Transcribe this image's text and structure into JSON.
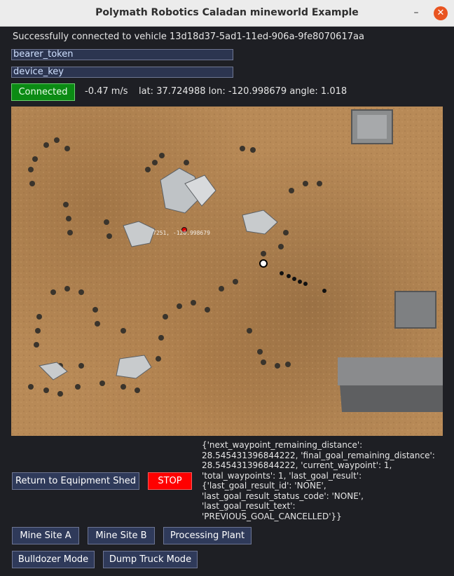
{
  "window": {
    "title": "Polymath Robotics Caladan mineworld Example",
    "min_label": "–",
    "close_label": "✕"
  },
  "status": {
    "message": "Successfully connected to vehicle 13d18d37-5ad1-11ed-906a-9fe8070617aa"
  },
  "fields": {
    "bearer_token": "bearer_token",
    "device_key": "device_key"
  },
  "connection": {
    "label": "Connected"
  },
  "telemetry": {
    "speed": "-0.47 m/s",
    "position": "lat: 37.724988 lon: -120.998679 angle: 1.018"
  },
  "map": {
    "overlay_text": "7251, -120.998679"
  },
  "buttons": {
    "return_shed": "Return to Equipment Shed",
    "stop": "STOP",
    "mine_a": "Mine Site A",
    "mine_b": "Mine Site B",
    "processing": "Processing Plant",
    "bulldozer": "Bulldozer Mode",
    "dump_truck": "Dump Truck Mode"
  },
  "result_text": "{'next_waypoint_remaining_distance':\n28.545431396844222, 'final_goal_remaining_distance':\n28.545431396844222, 'current_waypoint': 1,\n'total_waypoints': 1, 'last_goal_result':\n{'last_goal_result_id': 'NONE',\n'last_goal_result_status_code': 'NONE',\n'last_goal_result_text':\n'PREVIOUS_GOAL_CANCELLED'}}",
  "colors": {
    "connected": "#0b8b14",
    "stop": "#ff0000",
    "close": "#e95420",
    "window_bg": "#1e1f24"
  }
}
